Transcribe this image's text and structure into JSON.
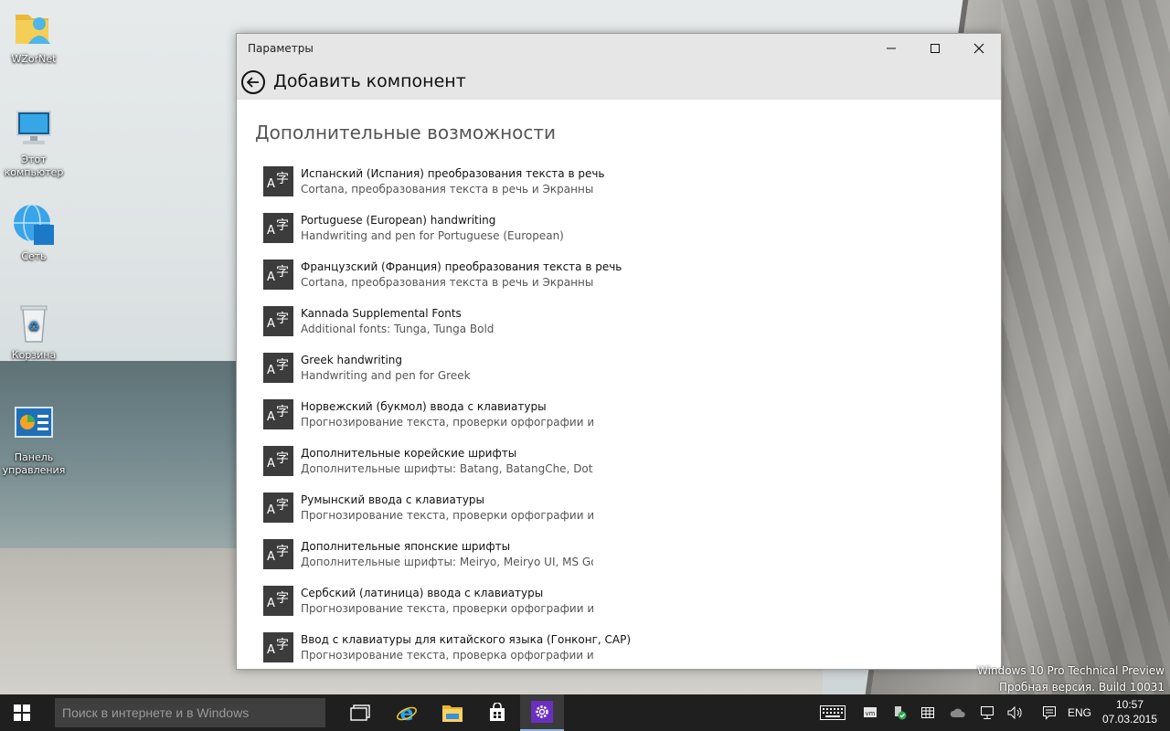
{
  "desktop": {
    "icons": [
      {
        "label": "WZorNet"
      },
      {
        "label": "Этот компьютер"
      },
      {
        "label": "Сеть"
      },
      {
        "label": "Корзина"
      },
      {
        "label": "Панель управления"
      }
    ],
    "watermark": {
      "line1": "Windows 10 Pro Technical Preview",
      "line2": "Пробная версия. Build 10031"
    }
  },
  "window": {
    "title": "Параметры",
    "header": "Добавить компонент",
    "section_title": "Дополнительные возможности",
    "items": [
      {
        "name": "Испанский (Испания) преобразования текста в речь",
        "desc": "Cortana, преобразования текста в речь и Экранный д..."
      },
      {
        "name": "Portuguese (European) handwriting",
        "desc": "Handwriting and pen for Portuguese (European)"
      },
      {
        "name": "Французский (Франция) преобразования текста в речь",
        "desc": "Cortana, преобразования текста в речь и Экранный д..."
      },
      {
        "name": "Kannada Supplemental Fonts",
        "desc": "Additional fonts: Tunga, Tunga Bold"
      },
      {
        "name": "Greek handwriting",
        "desc": "Handwriting and pen for Greek"
      },
      {
        "name": "Норвежский (букмол) ввода с клавиатуры",
        "desc": "Прогнозирование текста, проверки орфографии и до..."
      },
      {
        "name": "Дополнительные корейские шрифты",
        "desc": "Дополнительные шрифты: Batang, BatangChe, Dotum,..."
      },
      {
        "name": "Румынский ввода с клавиатуры",
        "desc": "Прогнозирование текста, проверки орфографии и по..."
      },
      {
        "name": "Дополнительные японские шрифты",
        "desc": "Дополнительные шрифты: Meiryo, Meiryo UI, MS Gothi..."
      },
      {
        "name": "Сербский (латиница) ввода с клавиатуры",
        "desc": "Прогнозирование текста, проверки орфографии и до..."
      },
      {
        "name": "Ввод с клавиатуры для китайского языка (Гонконг, САР)",
        "desc": "Прогнозирование текста, проверка орфографии и до..."
      }
    ],
    "item_icon_text": {
      "a": "A",
      "z": "字"
    }
  },
  "taskbar": {
    "search_placeholder": "Поиск в интернете и в Windows",
    "language": "ENG",
    "time": "10:57",
    "date": "07.03.2015"
  },
  "colors": {
    "taskbar": "#1f1f1f",
    "titlebar": "#e6e6e6",
    "item_icon_bg": "#3c3c3c",
    "settings_app": "#6b2fbf"
  }
}
